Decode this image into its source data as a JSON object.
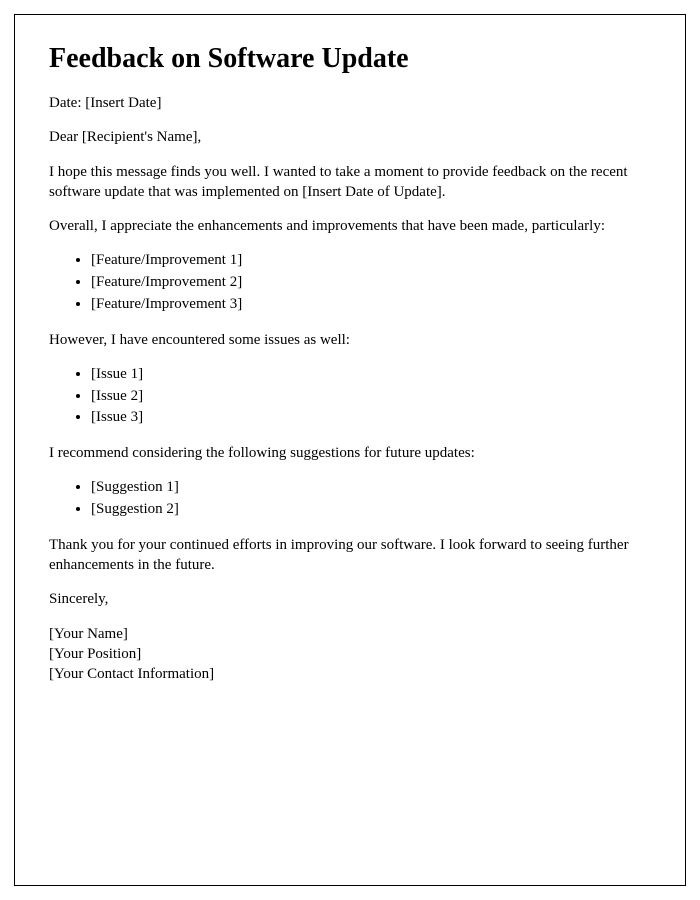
{
  "title": "Feedback on Software Update",
  "date_line": "Date: [Insert Date]",
  "salutation": "Dear [Recipient's Name],",
  "intro": "I hope this message finds you well. I wanted to take a moment to provide feedback on the recent software update that was implemented on [Insert Date of Update].",
  "improvements_intro": "Overall, I appreciate the enhancements and improvements that have been made, particularly:",
  "improvements": [
    "[Feature/Improvement 1]",
    "[Feature/Improvement 2]",
    "[Feature/Improvement 3]"
  ],
  "issues_intro": "However, I have encountered some issues as well:",
  "issues": [
    "[Issue 1]",
    "[Issue 2]",
    "[Issue 3]"
  ],
  "suggestions_intro": "I recommend considering the following suggestions for future updates:",
  "suggestions": [
    "[Suggestion 1]",
    "[Suggestion 2]"
  ],
  "closing": "Thank you for your continued efforts in improving our software. I look forward to seeing further enhancements in the future.",
  "signoff": "Sincerely,",
  "signature": {
    "name": "[Your Name]",
    "position": "[Your Position]",
    "contact": "[Your Contact Information]"
  }
}
